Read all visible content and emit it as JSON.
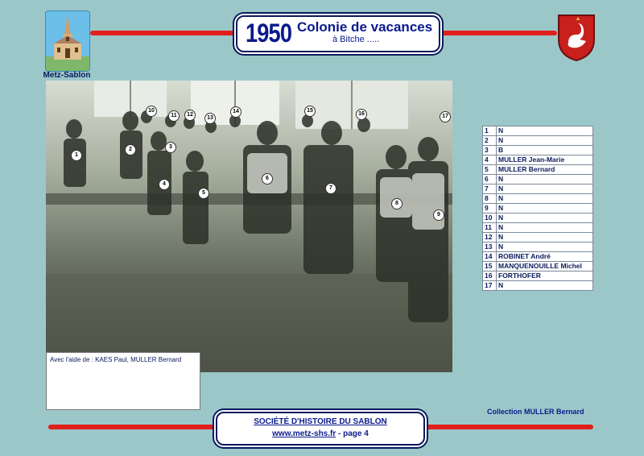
{
  "header": {
    "year": "1950",
    "title": "Colonie de vacances",
    "subtitle": "à Bitche ....."
  },
  "logo": {
    "caption": "Metz-Sablon",
    "icon": "church-icon",
    "shield_icon": "coat-of-arms-icon"
  },
  "photo": {
    "icon": "group-photo",
    "badges": [
      "1",
      "2",
      "3",
      "4",
      "5",
      "6",
      "7",
      "8",
      "9",
      "10",
      "11",
      "12",
      "13",
      "14",
      "15",
      "16",
      "17"
    ]
  },
  "credits": {
    "text": "Avec l'aide de : KAES Paul, MULLER Bernard"
  },
  "names": [
    {
      "num": "1",
      "name": "N"
    },
    {
      "num": "2",
      "name": "N"
    },
    {
      "num": "3",
      "name": "B"
    },
    {
      "num": "4",
      "name": "MULLER Jean-Marie"
    },
    {
      "num": "5",
      "name": "MULLER Bernard"
    },
    {
      "num": "6",
      "name": "N"
    },
    {
      "num": "7",
      "name": "N"
    },
    {
      "num": "8",
      "name": "N"
    },
    {
      "num": "9",
      "name": "N"
    },
    {
      "num": "10",
      "name": "N"
    },
    {
      "num": "11",
      "name": "N"
    },
    {
      "num": "12",
      "name": "N"
    },
    {
      "num": "13",
      "name": "N"
    },
    {
      "num": "14",
      "name": "ROBINET André"
    },
    {
      "num": "15",
      "name": "MANQUENOUILLE Michel"
    },
    {
      "num": "16",
      "name": "FORTHOFER"
    },
    {
      "num": "17",
      "name": "N"
    }
  ],
  "collection": "Collection MULLER Bernard",
  "footer": {
    "society": "SOCIÉTÉ D'HISTOIRE DU SABLON",
    "website": "www.metz-shs.fr",
    "separator": " - ",
    "page": "page 4"
  },
  "colors": {
    "background": "#9cc7c9",
    "accent_red": "#e0201c",
    "text_blue": "#0a1a8c"
  }
}
